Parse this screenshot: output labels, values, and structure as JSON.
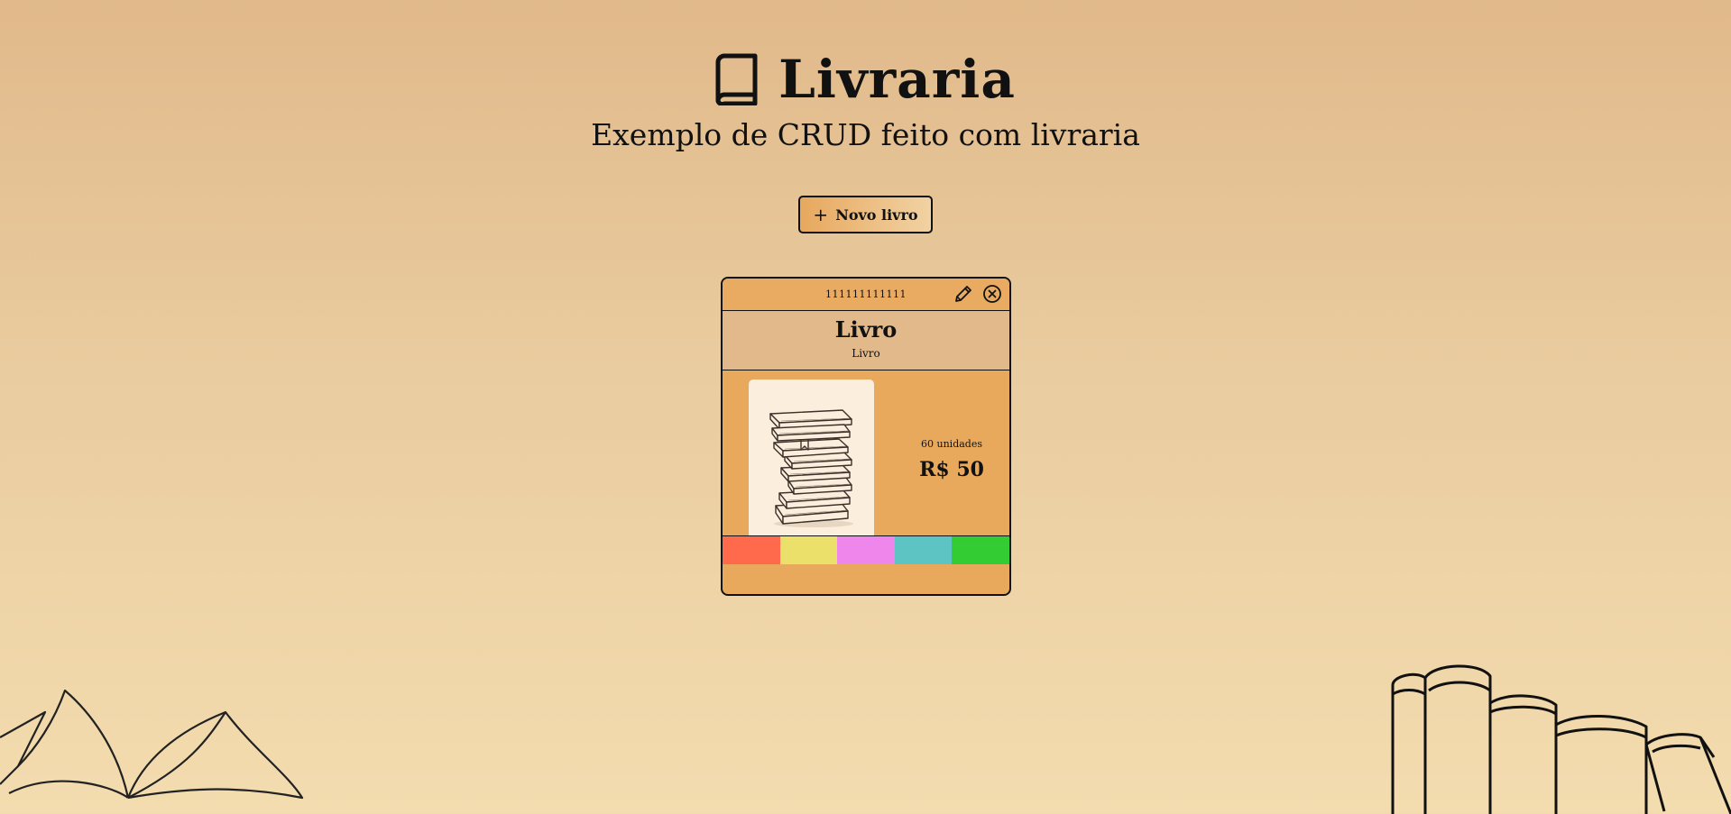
{
  "header": {
    "icon": "book-icon",
    "title": "Livraria",
    "subtitle": "Exemplo de CRUD feito com livraria"
  },
  "actions": {
    "new_book_label": "Novo livro",
    "new_book_icon": "plus-icon"
  },
  "books": [
    {
      "isbn": "111111111111",
      "title": "Livro",
      "author": "Livro",
      "stock": "60 unidades",
      "price": "R$ 50",
      "edit_icon": "pencil-icon",
      "delete_icon": "close-circle-icon",
      "cover_icon": "book-stack-illustration",
      "colors": [
        "#ff6a4d",
        "#ebe06a",
        "#ef86eb",
        "#5dc3c3",
        "#33cc33"
      ]
    }
  ],
  "theme": {
    "background_top": "#e1b98a",
    "background_bottom": "#f3dcaf",
    "card_accent": "#e8a95c"
  }
}
